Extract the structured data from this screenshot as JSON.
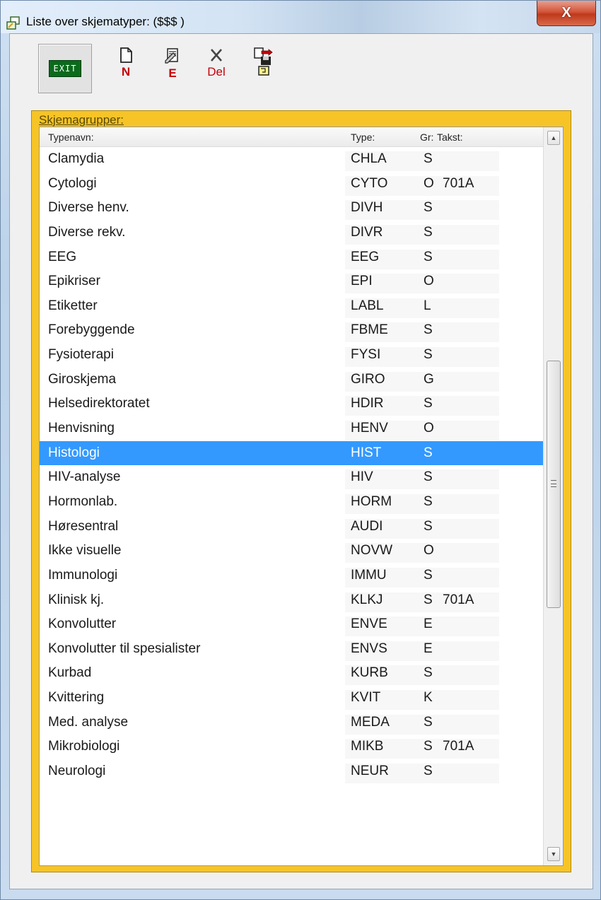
{
  "window": {
    "title": "Liste over skjematyper: ($$$ )",
    "close_label": "X"
  },
  "toolbar": {
    "exit_label": "EXIT",
    "new_label": "N",
    "edit_label": "E",
    "delete_label": "Del"
  },
  "group": {
    "label": "Skjemagrupper:"
  },
  "columns": {
    "name": "Typenavn:",
    "type": "Type:",
    "gr": "Gr:",
    "takst": "Takst:"
  },
  "rows": [
    {
      "name": "Clamydia",
      "type": "CHLA",
      "gr": "S",
      "takst": ""
    },
    {
      "name": "Cytologi",
      "type": "CYTO",
      "gr": "O",
      "takst": "701A"
    },
    {
      "name": "Diverse henv.",
      "type": "DIVH",
      "gr": "S",
      "takst": ""
    },
    {
      "name": "Diverse rekv.",
      "type": "DIVR",
      "gr": "S",
      "takst": ""
    },
    {
      "name": "EEG",
      "type": "EEG",
      "gr": "S",
      "takst": ""
    },
    {
      "name": "Epikriser",
      "type": "EPI",
      "gr": "O",
      "takst": ""
    },
    {
      "name": "Etiketter",
      "type": "LABL",
      "gr": "L",
      "takst": ""
    },
    {
      "name": "Forebyggende",
      "type": "FBME",
      "gr": "S",
      "takst": ""
    },
    {
      "name": "Fysioterapi",
      "type": "FYSI",
      "gr": "S",
      "takst": ""
    },
    {
      "name": "Giroskjema",
      "type": "GIRO",
      "gr": "G",
      "takst": ""
    },
    {
      "name": "Helsedirektoratet",
      "type": "HDIR",
      "gr": "S",
      "takst": ""
    },
    {
      "name": "Henvisning",
      "type": "HENV",
      "gr": "O",
      "takst": ""
    },
    {
      "name": "Histologi",
      "type": "HIST",
      "gr": "S",
      "takst": ""
    },
    {
      "name": "HIV-analyse",
      "type": "HIV",
      "gr": "S",
      "takst": ""
    },
    {
      "name": "Hormonlab.",
      "type": "HORM",
      "gr": "S",
      "takst": ""
    },
    {
      "name": "Høresentral",
      "type": "AUDI",
      "gr": "S",
      "takst": ""
    },
    {
      "name": "Ikke visuelle",
      "type": "NOVW",
      "gr": "O",
      "takst": ""
    },
    {
      "name": "Immunologi",
      "type": "IMMU",
      "gr": "S",
      "takst": ""
    },
    {
      "name": "Klinisk kj.",
      "type": "KLKJ",
      "gr": "S",
      "takst": "701A"
    },
    {
      "name": "Konvolutter",
      "type": "ENVE",
      "gr": "E",
      "takst": ""
    },
    {
      "name": "Konvolutter til spesialister",
      "type": "ENVS",
      "gr": "E",
      "takst": ""
    },
    {
      "name": "Kurbad",
      "type": "KURB",
      "gr": "S",
      "takst": ""
    },
    {
      "name": "Kvittering",
      "type": "KVIT",
      "gr": "K",
      "takst": ""
    },
    {
      "name": "Med. analyse",
      "type": "MEDA",
      "gr": "S",
      "takst": ""
    },
    {
      "name": "Mikrobiologi",
      "type": "MIKB",
      "gr": "S",
      "takst": "701A"
    },
    {
      "name": "Neurologi",
      "type": "NEUR",
      "gr": "S",
      "takst": ""
    }
  ],
  "selected_row": "Histologi",
  "colors": {
    "selection": "#3399ff",
    "group_frame": "#f6c427",
    "close_button": "#c0391b",
    "toolbar_label": "#c4000a"
  }
}
